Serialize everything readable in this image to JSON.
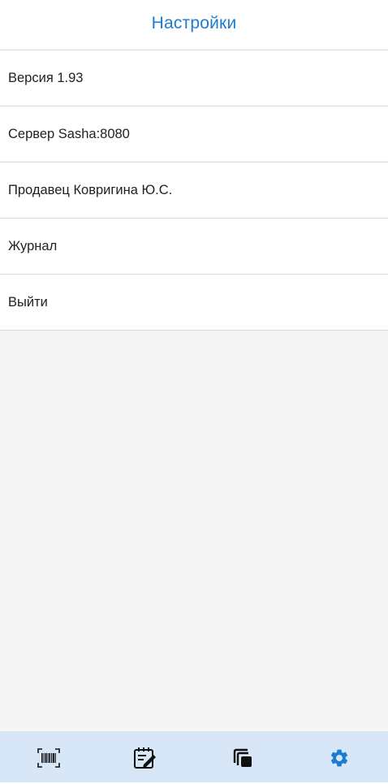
{
  "header": {
    "title": "Настройки"
  },
  "settings": {
    "items": [
      {
        "label": "Версия 1.93"
      },
      {
        "label": "Сервер Sasha:8080"
      },
      {
        "label": "Продавец Ковригина Ю.С."
      },
      {
        "label": "Журнал"
      },
      {
        "label": "Выйти"
      }
    ]
  },
  "bottom_nav": {
    "items": [
      {
        "icon": "barcode-scan-icon"
      },
      {
        "icon": "edit-note-icon"
      },
      {
        "icon": "copy-layers-icon"
      },
      {
        "icon": "settings-gear-icon",
        "active": true
      }
    ]
  },
  "colors": {
    "accent": "#1e7bd0",
    "nav_background": "#d7e7f8",
    "divider": "#d8d8d8",
    "content_background": "#f5f5f5"
  }
}
